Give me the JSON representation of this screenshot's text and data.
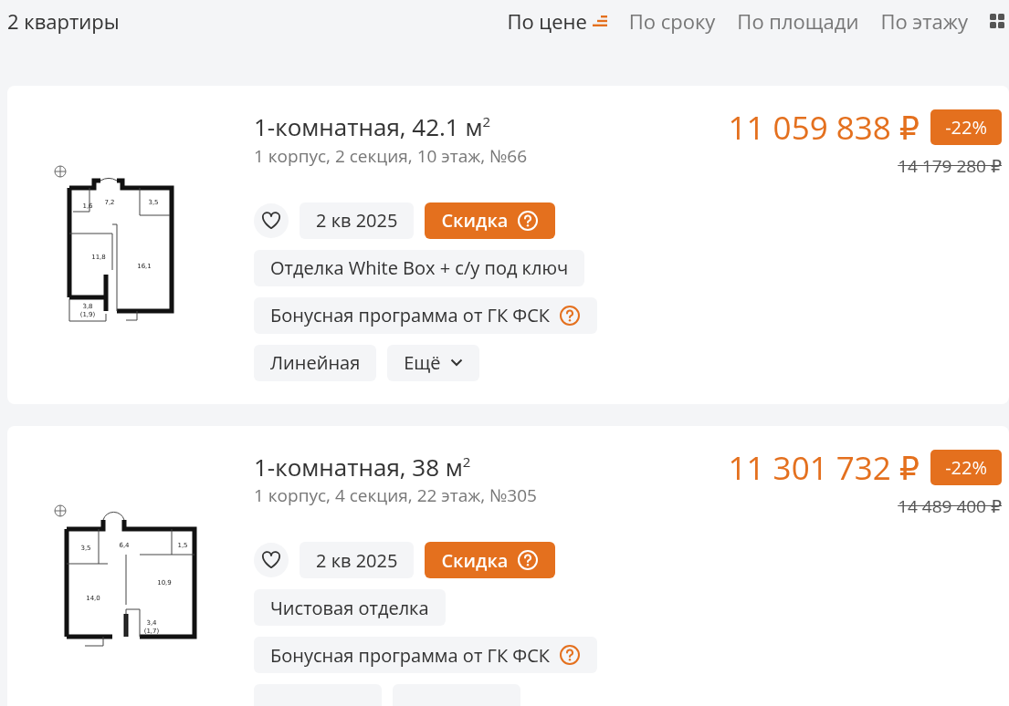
{
  "header": {
    "count": "2 квартиры",
    "sort_options": [
      {
        "label": "По цене",
        "selected": true
      },
      {
        "label": "По сроку",
        "selected": false
      },
      {
        "label": "По площади",
        "selected": false
      },
      {
        "label": "По этажу",
        "selected": false
      }
    ]
  },
  "listings": [
    {
      "plan": {
        "kind": "plan-a",
        "rooms": [
          "1,6",
          "7,2",
          "3,5",
          "11,8",
          "16,1",
          "3,8",
          "(1,9)"
        ]
      },
      "title": "1-комнатная, 42.1 м$^{2}$",
      "subtitle": "1 корпус, 2 секция, 10 этаж, №66",
      "favorite": false,
      "date": "2 кв 2025",
      "promo": "Скидка",
      "price": "11 059 838 ₽",
      "discount": "-22%",
      "old_price": "14 179 280 ₽",
      "tags": [
        {
          "kind": "plain",
          "text": "Отделка White Box + с/у под ключ"
        },
        {
          "kind": "help",
          "text": "Бонусная программа от ГК ФСК"
        },
        {
          "kind": "plain",
          "text": "Линейная"
        },
        {
          "kind": "more",
          "text": "Ещё"
        }
      ]
    },
    {
      "plan": {
        "kind": "plan-b",
        "rooms": [
          "3,5",
          "6,4",
          "1,5",
          "10,9",
          "14,0",
          "3,4",
          "(1,7)"
        ]
      },
      "title": "1-комнатная, 38 м$^{2}$",
      "subtitle": "1 корпус, 4 секция, 22 этаж, №305",
      "favorite": false,
      "date": "2 кв 2025",
      "promo": "Скидка",
      "price": "11 301 732 ₽",
      "discount": "-22%",
      "old_price": "14 489 400 ₽",
      "tags": [
        {
          "kind": "plain",
          "text": "Чистовая отделка"
        },
        {
          "kind": "help",
          "text": "Бонусная программа от ГК ФСК"
        },
        {
          "kind": "cut"
        },
        {
          "kind": "cut"
        }
      ]
    }
  ]
}
